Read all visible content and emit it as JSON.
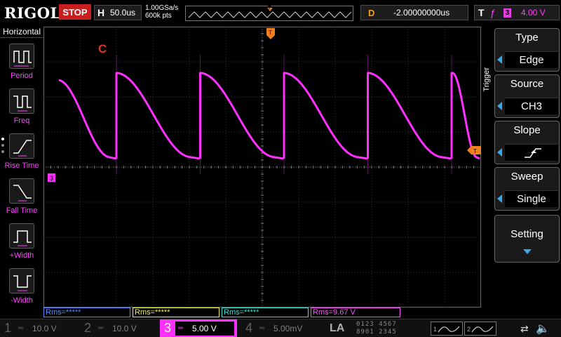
{
  "topbar": {
    "brand": "RIGOL",
    "run_state": "STOP",
    "horizontal_label": "H",
    "timebase": "50.0us",
    "sample_rate": "1.00GSa/s",
    "memory_depth": "600k pts",
    "trigger_position_marker": "T",
    "delay_label": "D",
    "delay_value": "-2.00000000us",
    "trigger_label": "T",
    "trigger_edge_glyph": "ƒ",
    "trigger_channel": "3",
    "trigger_level": "4.00 V"
  },
  "left_panel": {
    "title": "Horizontal",
    "measurements": [
      {
        "label": "Period",
        "icon": "period-icon"
      },
      {
        "label": "Freq",
        "icon": "frequency-icon"
      },
      {
        "label": "Rise Time",
        "icon": "rise-time-icon"
      },
      {
        "label": "Fall Time",
        "icon": "fall-time-icon"
      },
      {
        "label": "+Width",
        "icon": "positive-width-icon"
      },
      {
        "label": "-Width",
        "icon": "negative-width-icon"
      }
    ]
  },
  "display": {
    "waveform_label": "C",
    "trace_color": "#ff30ff",
    "channel_marker": "3",
    "trigger_level_marker": "T",
    "trigger_time_marker": "T"
  },
  "trigger_menu": {
    "title": "Trigger",
    "type_label": "Type",
    "type_value": "Edge",
    "source_label": "Source",
    "source_value": "CH3",
    "slope_label": "Slope",
    "slope_icon": "rising-edge-icon",
    "sweep_label": "Sweep",
    "sweep_value": "Single",
    "setting_label": "Setting"
  },
  "measurement_bar": {
    "ch1": "Rms=*****",
    "ch2": "Rms=*****",
    "ch3": "Rms=*****",
    "ch4": "Rms=9.67 V"
  },
  "channels": [
    {
      "number": "1",
      "coupling": "═",
      "scale": "10.0 V",
      "active": false
    },
    {
      "number": "2",
      "coupling": "═",
      "scale": "10.0 V",
      "active": false
    },
    {
      "number": "3",
      "coupling": "═",
      "scale": "5.00 V",
      "active": true
    },
    {
      "number": "4",
      "coupling": "═",
      "scale": "5.00mV",
      "active": false
    }
  ],
  "bottombar": {
    "la_label": "LA",
    "digital_row1": "0123 4567",
    "digital_row2": "8901 2345",
    "source1": "1",
    "source2": "2",
    "usb_glyph": "⇄",
    "speaker_glyph": "🔈"
  },
  "colors": {
    "ch1": "#f0f060",
    "ch2": "#40e0d0",
    "ch3": "#ff30ff",
    "ch4": "#5b8cff",
    "stop": "#c81e1e",
    "accent": "#3aa8e8"
  }
}
